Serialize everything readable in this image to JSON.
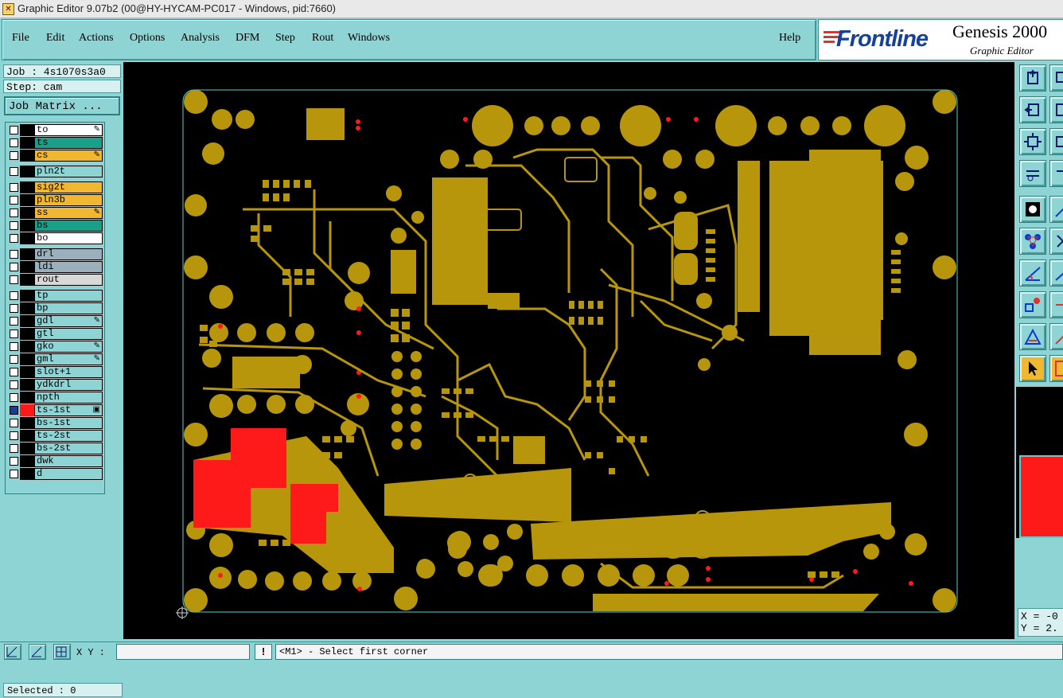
{
  "window": {
    "title": "Graphic Editor 9.07b2 (00@HY-HYCAM-PC017 - Windows, pid:7660)"
  },
  "menu": {
    "items": [
      "File",
      "Edit",
      "Actions",
      "Options",
      "Analysis",
      "DFM",
      "Step",
      "Rout",
      "Windows"
    ],
    "help": "Help"
  },
  "brand": {
    "logo": "Frontline",
    "product": "Genesis 2000",
    "subtitle": "Graphic Editor"
  },
  "job": {
    "job_label": "Job : 4s1070s3a0",
    "step_label": "Step: cam",
    "matrix_button": "Job Matrix ..."
  },
  "layers": [
    {
      "name": "to",
      "bg": "#ffffff",
      "mark": "✎"
    },
    {
      "name": "ts",
      "bg": "#1aa088",
      "mark": ""
    },
    {
      "name": "cs",
      "bg": "#f0b830",
      "mark": "✎"
    },
    {
      "name": "pln2t",
      "bg": "#8fd4d4",
      "mark": ""
    },
    {
      "name": "sig2t",
      "bg": "#f0b830",
      "mark": ""
    },
    {
      "name": "pln3b",
      "bg": "#f0b830",
      "mark": ""
    },
    {
      "name": "ss",
      "bg": "#f0b830",
      "mark": "✎"
    },
    {
      "name": "bs",
      "bg": "#1aa088",
      "mark": ""
    },
    {
      "name": "bo",
      "bg": "#ffffff",
      "mark": ""
    },
    {
      "name": "drl",
      "bg": "#9ab0bc",
      "mark": ""
    },
    {
      "name": "ldi",
      "bg": "#9ab0bc",
      "mark": ""
    },
    {
      "name": "rout",
      "bg": "#d8d8d8",
      "mark": ""
    },
    {
      "name": "tp",
      "bg": "#8fd4d4",
      "mark": ""
    },
    {
      "name": "bp",
      "bg": "#8fd4d4",
      "mark": ""
    },
    {
      "name": "gdl",
      "bg": "#8fd4d4",
      "mark": "✎"
    },
    {
      "name": "gtl",
      "bg": "#8fd4d4",
      "mark": ""
    },
    {
      "name": "gko",
      "bg": "#8fd4d4",
      "mark": "✎"
    },
    {
      "name": "gml",
      "bg": "#8fd4d4",
      "mark": "✎"
    },
    {
      "name": "slot+1",
      "bg": "#8fd4d4",
      "mark": ""
    },
    {
      "name": "ydkdrl",
      "bg": "#8fd4d4",
      "mark": ""
    },
    {
      "name": "npth",
      "bg": "#8fd4d4",
      "mark": ""
    },
    {
      "name": "ts-1st",
      "bg": "#8fd4d4",
      "mark": "▣"
    },
    {
      "name": "bs-1st",
      "bg": "#8fd4d4",
      "mark": ""
    },
    {
      "name": "ts-2st",
      "bg": "#8fd4d4",
      "mark": ""
    },
    {
      "name": "bs-2st",
      "bg": "#8fd4d4",
      "mark": ""
    },
    {
      "name": "dwk",
      "bg": "#8fd4d4",
      "mark": ""
    },
    {
      "name": "d",
      "bg": "#8fd4d4",
      "mark": ""
    }
  ],
  "status": {
    "selected": "Selected : 0",
    "xy_label": "X Y :",
    "xy_value": "",
    "prompt": "<M1> - Select first corner",
    "coord_x": "X = -0",
    "coord_y": "Y = 2."
  },
  "colors": {
    "copper": "#b8960c",
    "pad_red": "#ff1a1a",
    "panel": "#8fd4d4",
    "canvas": "#000000"
  }
}
